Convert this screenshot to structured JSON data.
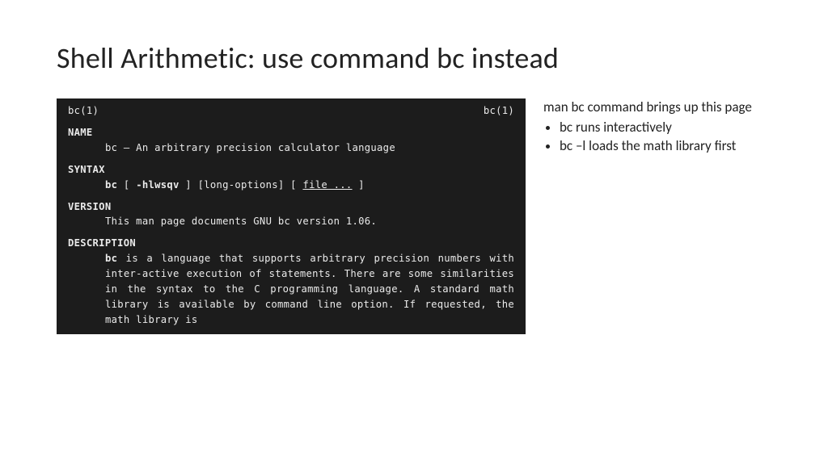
{
  "title_pre": "Shell Arithmetic: use command ",
  "title_cmd": "bc",
  "title_post": " instead",
  "man": {
    "header_left": "bc(1)",
    "header_right": "bc(1)",
    "name_hdr": "NAME",
    "name_line": "bc – An arbitrary precision calculator language",
    "syntax_hdr": "SYNTAX",
    "syntax_cmd": "bc",
    "syntax_opts_b": "-hlwsqv",
    "syntax_mid": "[long-options] [",
    "syntax_file": "file ...",
    "version_hdr": "VERSION",
    "version_line": "This man page documents GNU bc version 1.06.",
    "desc_hdr": "DESCRIPTION",
    "desc_cmd": "bc",
    "desc_body": "  is a language that supports arbitrary precision numbers with inter-active execution of statements.  There  are  some  similarities  in  the syntax  to  the  C  programming  language.   A standard math library is available by command line option.  If requested, the  math  library  is"
  },
  "notes": {
    "line1": "man bc command brings up this page",
    "bullets": [
      "bc runs interactively",
      "bc –l loads the math library first"
    ]
  }
}
